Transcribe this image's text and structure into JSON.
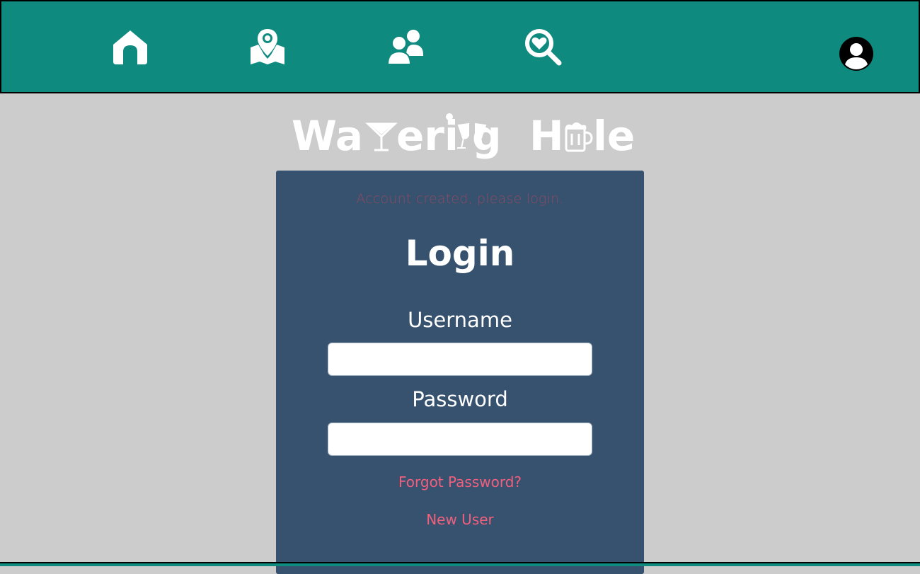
{
  "nav": {
    "icons": [
      "home-icon",
      "map-pin-icon",
      "friends-icon",
      "search-heart-icon",
      "profile-avatar-icon"
    ]
  },
  "logo": {
    "text": "Watering Hole"
  },
  "login": {
    "notice": "Account created, please login.",
    "title": "Login",
    "username_label": "Username",
    "username_value": "",
    "password_label": "Password",
    "password_value": "",
    "forgot_link": "Forgot Password?",
    "new_user_link": "New User"
  },
  "colors": {
    "header": "#0e8a7e",
    "background": "#cccccc",
    "panel": "#36526f",
    "link": "#f0607e",
    "notice": "#8c4a63"
  }
}
